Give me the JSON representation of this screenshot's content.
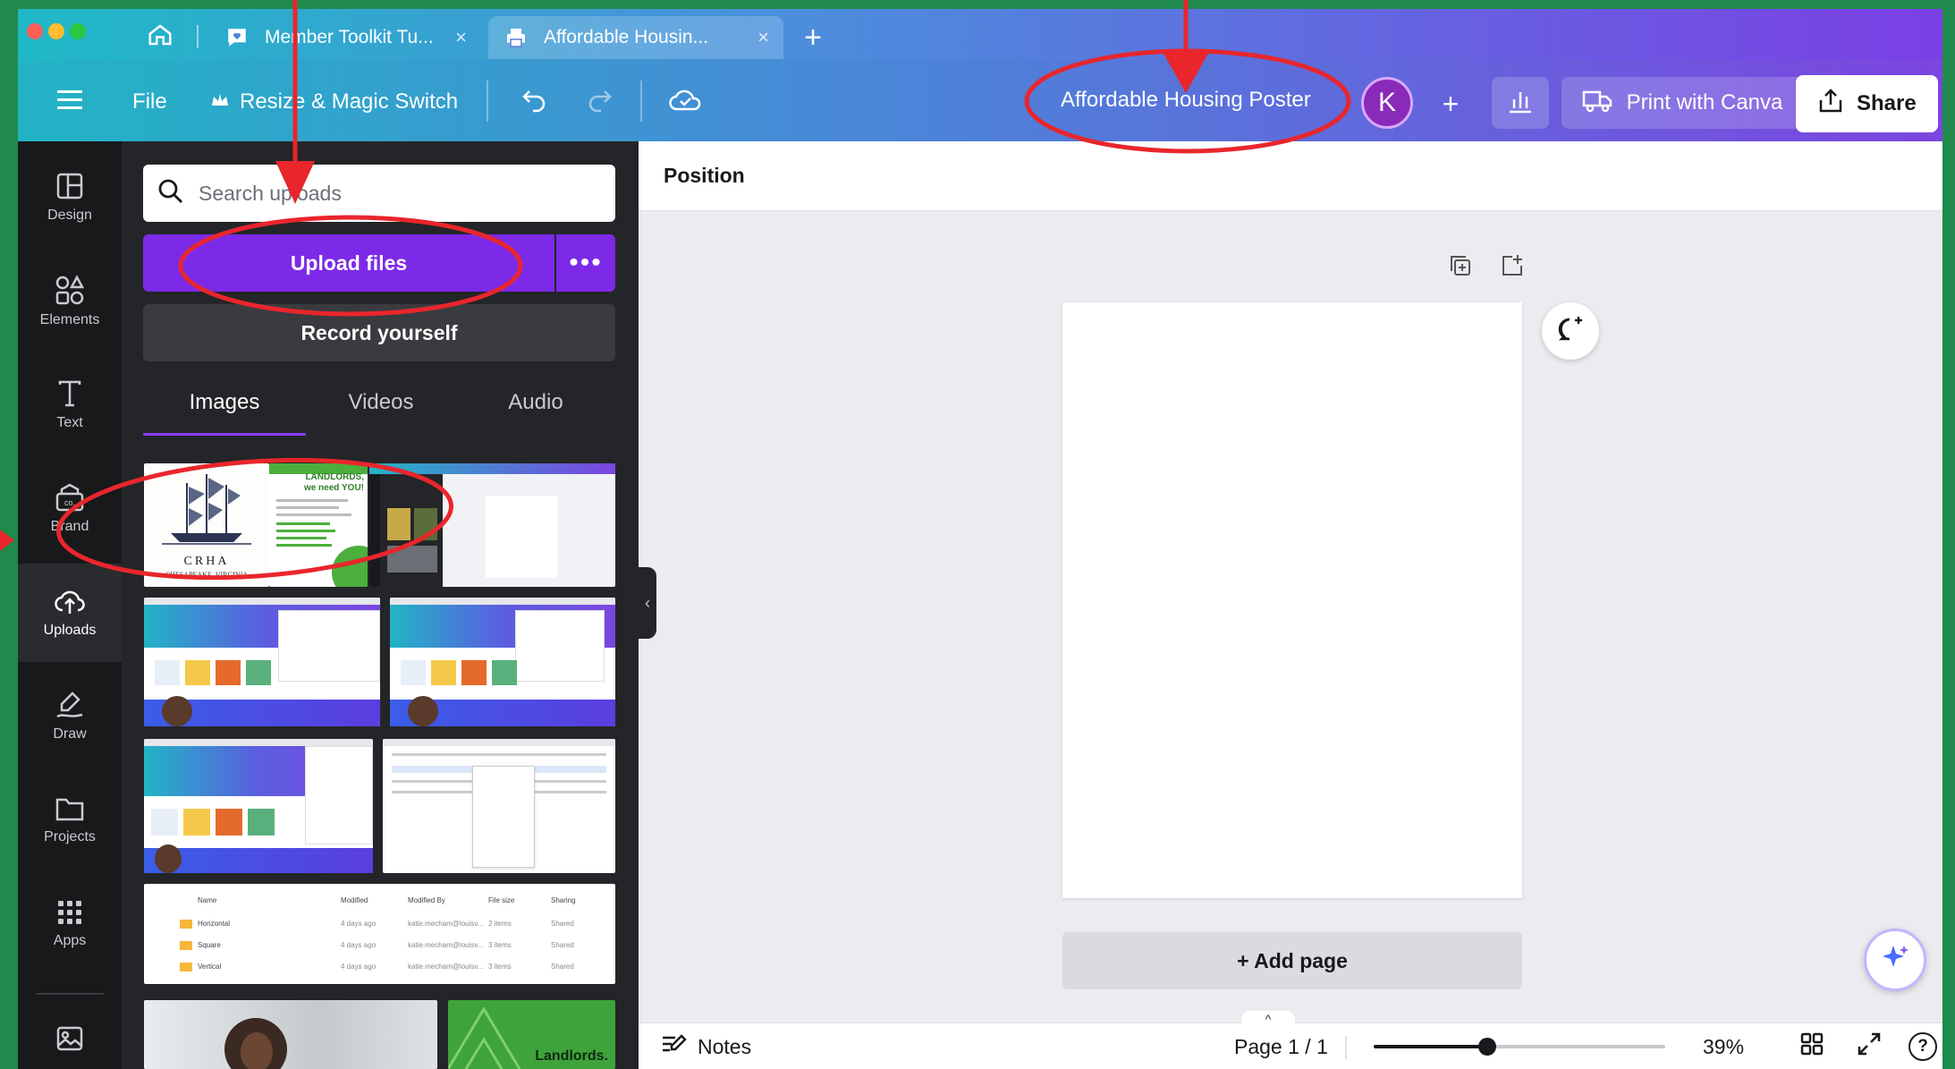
{
  "browser": {
    "tabs": [
      {
        "label": "Member Toolkit Tu...",
        "active": false
      },
      {
        "label": "Affordable Housin...",
        "active": true
      }
    ],
    "close_glyph": "×",
    "new_tab_glyph": "+"
  },
  "toolbar": {
    "file_label": "File",
    "resize_label": "Resize & Magic Switch",
    "design_title": "Affordable Housing Poster",
    "avatar_initial": "K",
    "print_label": "Print with Canva",
    "share_label": "Share",
    "add_glyph": "+"
  },
  "rail": {
    "items": [
      {
        "label": "Design",
        "icon": "layout-icon"
      },
      {
        "label": "Elements",
        "icon": "shapes-icon"
      },
      {
        "label": "Text",
        "icon": "text-icon"
      },
      {
        "label": "Brand",
        "icon": "brand-icon"
      },
      {
        "label": "Uploads",
        "icon": "cloud-upload-icon",
        "active": true
      },
      {
        "label": "Draw",
        "icon": "pen-icon"
      },
      {
        "label": "Projects",
        "icon": "folder-icon"
      },
      {
        "label": "Apps",
        "icon": "grid-icon"
      }
    ]
  },
  "panel": {
    "search_placeholder": "Search uploads",
    "upload_label": "Upload files",
    "more_glyph": "•••",
    "record_label": "Record yourself",
    "tabs": [
      "Images",
      "Videos",
      "Audio"
    ],
    "active_tab": "Images",
    "thumb_texts": {
      "crha_title": "CRHA",
      "crha_subtitle": "CHESAPEAKE, VIRGINIA",
      "landlords_heading": "LANDLORDS,",
      "landlords_sub": "we need YOU!",
      "landlords_tile": "Landlords."
    },
    "file_table": {
      "headers": [
        "Name",
        "Modified",
        "Modified By",
        "File size",
        "Sharing"
      ],
      "rows": [
        [
          "Horizontal",
          "4 days ago",
          "katie.mecham@louisv...",
          "2 items",
          "Shared"
        ],
        [
          "Square",
          "4 days ago",
          "katie.mecham@louisv...",
          "3 items",
          "Shared"
        ],
        [
          "Vertical",
          "4 days ago",
          "katie.mecham@louisv...",
          "3 items",
          "Shared"
        ]
      ]
    }
  },
  "canvas": {
    "position_label": "Position",
    "add_page_label": "+ Add page",
    "collapse_glyph": "‹"
  },
  "footer": {
    "notes_label": "Notes",
    "page_indicator": "Page 1 / 1",
    "zoom_percent": "39%",
    "zoom_level": 0.39,
    "expand_glyph": "^",
    "help_glyph": "?"
  },
  "colors": {
    "accent_purple": "#7d2ae8",
    "annotation_red": "#e8262c",
    "background_green": "#1f8a4c"
  }
}
